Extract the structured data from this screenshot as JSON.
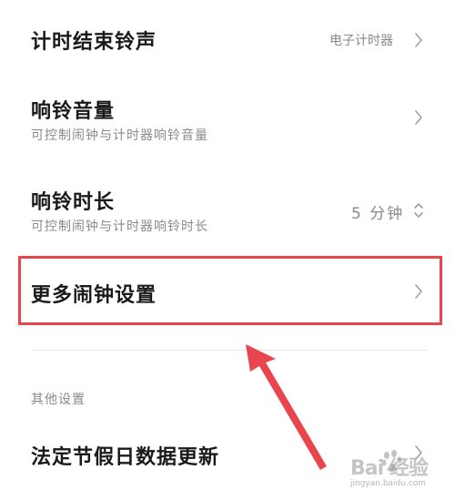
{
  "settings": {
    "timer_ringtone": {
      "title": "计时结束铃声",
      "value": "电子计时器"
    },
    "ring_volume": {
      "title": "响铃音量",
      "subtitle": "可控制闹钟与计时器响铃音量"
    },
    "ring_duration": {
      "title": "响铃时长",
      "subtitle": "可控制闹钟与计时器响铃时长",
      "value": "5 分钟"
    },
    "more_alarm_settings": {
      "title": "更多闹钟设置"
    }
  },
  "other_section": {
    "header": "其他设置",
    "holiday_update": {
      "title": "法定节假日数据更新"
    }
  },
  "watermark": {
    "text": "Bai 经验",
    "url": "jingyan.baidu.com"
  },
  "colors": {
    "highlight": "#e8464c",
    "title_text": "#1a1a1a",
    "secondary_text": "#8a8a8a",
    "divider": "#e6e6e6"
  },
  "icons": {
    "chevron": "chevron-right-icon",
    "stepper": "up-down-chevron-icon",
    "annotation": "red-arrow-annotation",
    "logo": "baidu-paw-logo"
  }
}
